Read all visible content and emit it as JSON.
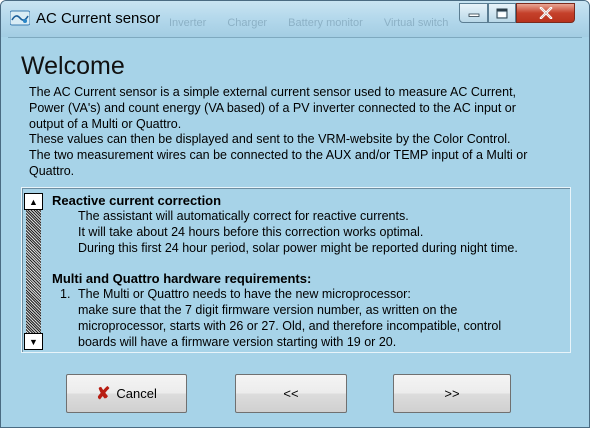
{
  "window": {
    "title": "AC Current sensor",
    "background_tabs": [
      "Inverter",
      "Charger",
      "Battery monitor",
      "Virtual switch"
    ]
  },
  "page": {
    "title": "Welcome",
    "intro": [
      "The AC Current sensor is a simple external current sensor used to measure AC Current,",
      "Power (VA's) and count energy (VA based) of a PV inverter connected to the AC input or",
      "output of a Multi or Quattro.",
      "These values can then be displayed and sent to the VRM-website by the Color Control.",
      "The two measurement wires can be connected to the AUX and/or TEMP input of a Multi or",
      "Quattro."
    ]
  },
  "info": {
    "section1": {
      "heading": "Reactive current correction",
      "lines": [
        "The assistant will automatically correct for reactive currents.",
        "It will take about 24 hours before this correction works optimal.",
        "During this first 24 hour period, solar power might be reported during night time."
      ]
    },
    "section2": {
      "heading": "Multi and Quattro hardware requirements:",
      "item_number": "1.",
      "lines": [
        "The Multi or Quattro needs to have the new microprocessor:",
        "make sure that the 7 digit firmware version number, as written on the",
        "microprocessor, starts with 26 or 27. Old, and therefore incompatible, control",
        "boards will have a firmware version starting with 19 or 20."
      ]
    }
  },
  "buttons": {
    "cancel": "Cancel",
    "back": "<<",
    "next": ">>"
  },
  "icons": {
    "minimize": "minimize-icon",
    "maximize": "maximize-icon",
    "close": "close-icon",
    "cancel": "x-icon",
    "scroll_up": "up-arrow-icon",
    "scroll_down": "down-arrow-icon"
  },
  "colors": {
    "window_bg": "#a7d3e8",
    "close_button": "#c5412b",
    "cancel_icon": "#b81d12"
  }
}
